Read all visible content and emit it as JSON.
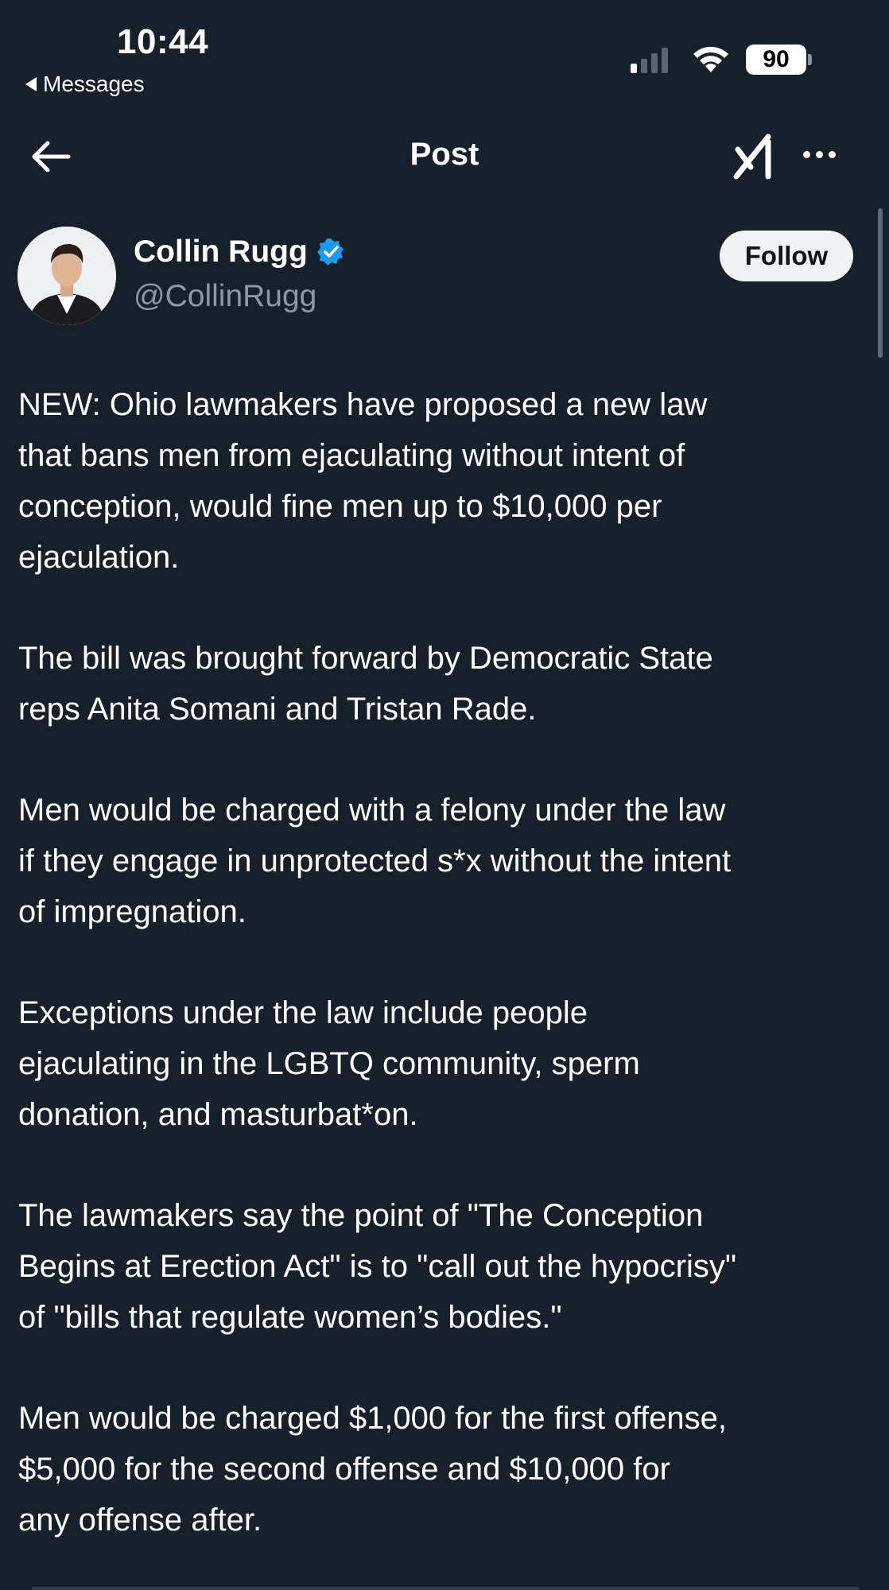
{
  "status_bar": {
    "time": "10:44",
    "back_app_label": "Messages",
    "battery_level": "90",
    "signal_bars_active": 1,
    "signal_bars_total": 4
  },
  "nav": {
    "title": "Post",
    "back_icon": "arrow-left-icon",
    "grok_icon": "grok-icon",
    "more_icon": "more-horizontal-icon"
  },
  "author": {
    "display_name": "Collin Rugg",
    "handle": "@CollinRugg",
    "verified": true,
    "follow_label": "Follow"
  },
  "post": {
    "paragraphs": [
      "NEW: Ohio lawmakers have proposed a new law\nthat bans men from ejaculating without intent of\nconception, would fine men up to $10,000 per\nejaculation.",
      "The bill was brought forward by Democratic State\nreps Anita Somani and Tristan Rade.",
      "Men would be charged with a felony under the law\nif they engage in unprotected s*x without the intent\nof impregnation.",
      "Exceptions under the law include people\nejaculating in the LGBTQ community, sperm\ndonation, and masturbat*on.",
      "The lawmakers say the point of \"The Conception\nBegins at Erection Act\" is to \"call out the hypocrisy\"\nof \"bills that regulate women’s bodies.\"",
      "Men would be charged $1,000 for the first offense,\n$5,000 for the second offense and $10,000 for\nany offense after."
    ]
  },
  "colors": {
    "background": "#15202b",
    "text": "#ffffff",
    "secondary_text": "#8b98a5",
    "verified_blue": "#1d9bf0",
    "follow_bg": "#eff3f4"
  }
}
